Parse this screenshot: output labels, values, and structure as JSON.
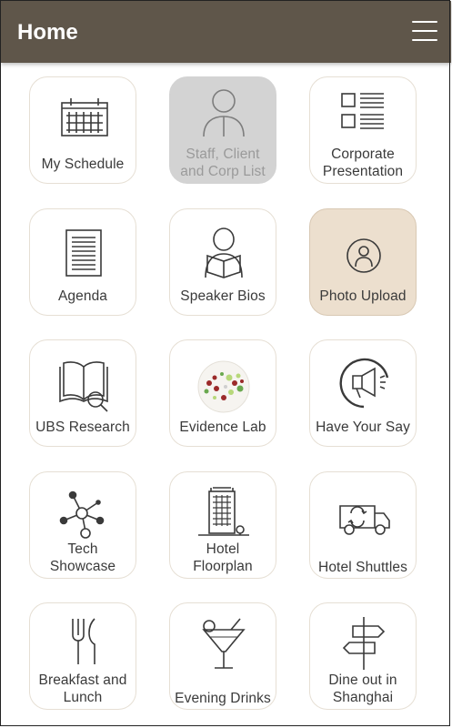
{
  "header": {
    "title": "Home"
  },
  "tiles": {
    "my_schedule": "My Schedule",
    "staff_list_1": "Staff, Client",
    "staff_list_2": "and Corp List",
    "corp_pres_1": "Corporate",
    "corp_pres_2": "Presentation",
    "agenda": "Agenda",
    "speaker_bios": "Speaker Bios",
    "photo_upload": "Photo Upload",
    "ubs_research": "UBS Research",
    "evidence_lab": "Evidence Lab",
    "have_your_say": "Have Your Say",
    "tech_1": "Tech",
    "tech_2": "Showcase",
    "hotel_fp_1": "Hotel",
    "hotel_fp_2": "Floorplan",
    "hotel_shuttles": "Hotel Shuttles",
    "breakfast_1": "Breakfast and",
    "breakfast_2": "Lunch",
    "evening_drinks": "Evening Drinks",
    "dine_1": "Dine out in",
    "dine_2": "Shanghai"
  },
  "icons": {
    "my_schedule": "calendar-icon",
    "staff_list": "person-icon",
    "corp_pres": "checklist-icon",
    "agenda": "document-icon",
    "speaker_bios": "reading-person-icon",
    "photo_upload": "camera-person-icon",
    "ubs_research": "book-search-icon",
    "evidence_lab": "dots-globe-icon",
    "have_your_say": "megaphone-icon",
    "tech_showcase": "network-icon",
    "hotel_floorplan": "building-icon",
    "hotel_shuttles": "van-icon",
    "breakfast_lunch": "fork-knife-icon",
    "evening_drinks": "cocktail-icon",
    "dine_out": "signpost-icon"
  },
  "colors": {
    "header_bg": "#5f564a",
    "tile_border": "#e6dfd4",
    "tile_disabled": "#d3d3d3",
    "tile_active": "#ecdfce",
    "icon_stroke": "#3a3a3a"
  }
}
